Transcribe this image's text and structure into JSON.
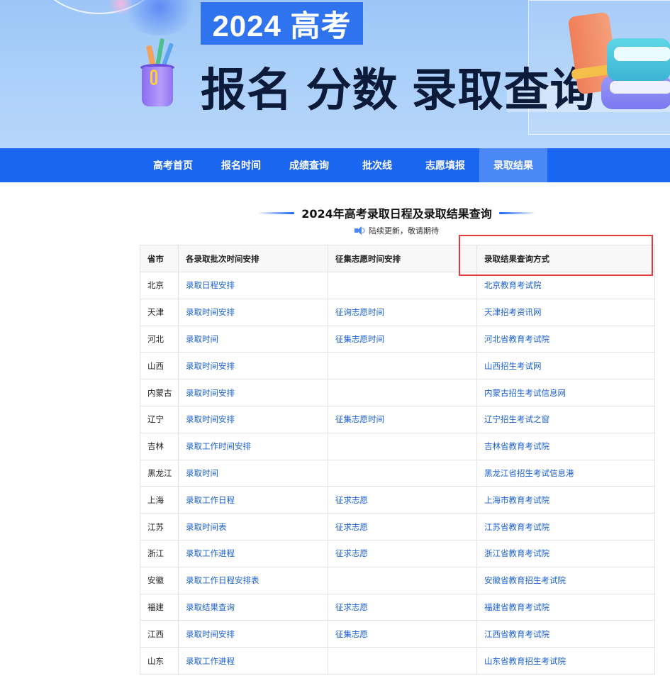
{
  "banner": {
    "year": "2024 高考",
    "headline": "报名 分数 录取查询"
  },
  "nav": {
    "items": [
      {
        "label": "高考首页",
        "active": false
      },
      {
        "label": "报名时间",
        "active": false
      },
      {
        "label": "成绩查询",
        "active": false
      },
      {
        "label": "批次线",
        "active": false
      },
      {
        "label": "志愿填报",
        "active": false
      },
      {
        "label": "录取结果",
        "active": true
      }
    ]
  },
  "section": {
    "title": "2024年高考录取日程及录取结果查询",
    "notice": "陆续更新，敬请期待"
  },
  "table": {
    "headers": [
      "省市",
      "各录取批次时间安排",
      "征集志愿时间安排",
      "录取结果查询方式"
    ],
    "rows": [
      {
        "province": "北京",
        "schedule": "录取日程安排",
        "collect": "",
        "query": "北京教育考试院"
      },
      {
        "province": "天津",
        "schedule": "录取时间安排",
        "collect": "征询志愿时间",
        "query": "天津招考资讯网"
      },
      {
        "province": "河北",
        "schedule": "录取时间",
        "collect": "征集志愿时间",
        "query": "河北省教育考试院"
      },
      {
        "province": "山西",
        "schedule": "录取时间安排",
        "collect": "",
        "query": "山西招生考试网"
      },
      {
        "province": "内蒙古",
        "schedule": "录取时间安排",
        "collect": "",
        "query": "内蒙古招生考试信息网"
      },
      {
        "province": "辽宁",
        "schedule": "录取时间安排",
        "collect": "征集志愿时间",
        "query": "辽宁招生考试之窗"
      },
      {
        "province": "吉林",
        "schedule": "录取工作时间安排",
        "collect": "",
        "query": "吉林省教育考试院"
      },
      {
        "province": "黑龙江",
        "schedule": "录取时间",
        "collect": "",
        "query": "黑龙江省招生考试信息港"
      },
      {
        "province": "上海",
        "schedule": "录取工作日程",
        "collect": "征求志愿",
        "query": "上海市教育考试院"
      },
      {
        "province": "江苏",
        "schedule": "录取时间表",
        "collect": "征求志愿",
        "query": "江苏省教育考试院"
      },
      {
        "province": "浙江",
        "schedule": "录取工作进程",
        "collect": "征求志愿",
        "query": "浙江省教育考试院"
      },
      {
        "province": "安徽",
        "schedule": "录取工作日程安排表",
        "collect": "",
        "query": "安徽省教育招生考试院"
      },
      {
        "province": "福建",
        "schedule": "录取结果查询",
        "collect": "征求志愿",
        "query": "福建省教育考试院"
      },
      {
        "province": "江西",
        "schedule": "录取时间安排",
        "collect": "征集志愿",
        "query": "江西省教育考试院"
      },
      {
        "province": "山东",
        "schedule": "录取工作进程",
        "collect": "",
        "query": "山东省教育招生考试院"
      }
    ]
  },
  "colors": {
    "nav_bg": "#1a66f0",
    "nav_active": "#4a88f5",
    "link": "#1a5fd0",
    "highlight": "#e5383b"
  }
}
